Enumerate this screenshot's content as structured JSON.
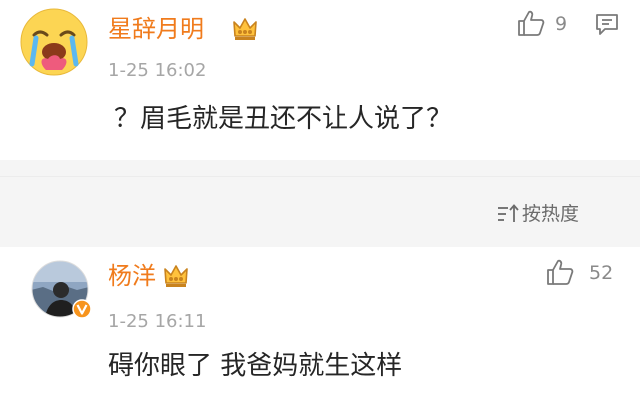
{
  "comments": [
    {
      "username": "星辞月明",
      "time": "1-25 16:02",
      "text": "？眉毛就是丑还不让人说了？",
      "likes": "9",
      "avatar_icon": "crying-emoji-avatar",
      "badge_icon": "crown-badge-icon"
    },
    {
      "username": "杨洋",
      "time": "1-25 16:11",
      "text": "碍你眼了 我爸妈就生这样",
      "likes": "52",
      "avatar_icon": "photo-avatar",
      "badge_icon": "crown-badge-icon",
      "verified_icon": "verified-v-icon"
    }
  ],
  "sort": {
    "label": "按热度",
    "icon": "sort-icon"
  },
  "colors": {
    "username": "#f07b1c",
    "text": "#262626",
    "meta": "#a6a6a6",
    "verified": "#f7941d"
  }
}
